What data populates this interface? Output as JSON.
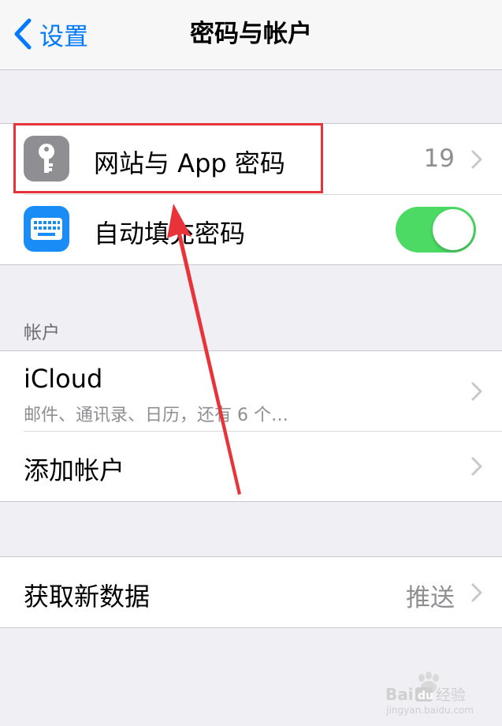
{
  "navbar": {
    "back_label": "设置",
    "title": "密码与帐户"
  },
  "passwords_group": {
    "website_passwords": {
      "label": "网站与 App 密码",
      "count": "19",
      "icon": "key-icon",
      "icon_color": "#8e8e93"
    },
    "autofill": {
      "label": "自动填充密码",
      "icon": "keyboard-icon",
      "icon_color": "#1a8cf5",
      "toggle_on": true
    }
  },
  "accounts_section": {
    "header": "帐户",
    "icloud": {
      "label": "iCloud",
      "subtitle": "邮件、通讯录、日历，还有 6 个…"
    },
    "add_account": {
      "label": "添加帐户"
    }
  },
  "fetch_group": {
    "fetch_new_data": {
      "label": "获取新数据",
      "value": "推送"
    }
  },
  "watermark": {
    "brand": "Baidu经验",
    "url": "jingyan.baidu.com"
  },
  "colors": {
    "accent": "#007aff",
    "toggle_green": "#4cd964",
    "annotation_red": "#e8333a"
  }
}
